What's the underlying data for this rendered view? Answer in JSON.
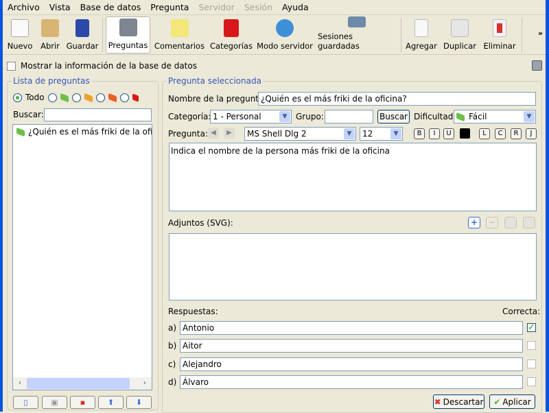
{
  "menu": [
    "Archivo",
    "Vista",
    "Base de datos",
    "Pregunta",
    "Servidor",
    "Sesión",
    "Ayuda"
  ],
  "menu_disabled": [
    "Servidor",
    "Sesión"
  ],
  "toolbar": {
    "nuevo": "Nuevo",
    "abrir": "Abrir",
    "guardar": "Guardar",
    "preguntas": "Preguntas",
    "comentarios": "Comentarios",
    "categorias": "Categorías",
    "modo_servidor": "Modo servidor",
    "sesiones": "Sesiones guardadas",
    "agregar": "Agregar",
    "duplicar": "Duplicar",
    "eliminar": "Eliminar",
    "more": "»"
  },
  "show_db_info": {
    "label": "Mostrar la información de la base de datos",
    "checked": false
  },
  "left": {
    "title": "Lista de preguntas",
    "filter_all": "Todo",
    "search_label": "Buscar:",
    "search_value": "",
    "items": [
      "¿Quién es el más friki de la oficina"
    ]
  },
  "right": {
    "title": "Pregunta seleccionada",
    "name_label": "Nombre de la pregunta:",
    "name_value": "¿Quién es el más friki de la oficina?",
    "category_label": "Categoría:",
    "category_value": "1 - Personal",
    "group_label": "Grupo:",
    "group_value": "",
    "search_button": "Buscar",
    "difficulty_label": "Dificultad:",
    "difficulty_value": "Fácil",
    "question_label": "Pregunta:",
    "font": "MS Shell Dlg 2",
    "size": "12",
    "format": [
      "B",
      "I",
      "U"
    ],
    "align": [
      "L",
      "C",
      "R",
      "J"
    ],
    "text": "Indica el nombre de la persona más friki de la oficina",
    "attachments_label": "Adjuntos (SVG):",
    "answers_label": "Respuestas:",
    "correct_label": "Correcta:",
    "answers": [
      {
        "key": "a)",
        "text": "Antonio",
        "correct": true
      },
      {
        "key": "b)",
        "text": "Aitor",
        "correct": false
      },
      {
        "key": "c)",
        "text": "Alejandro",
        "correct": false
      },
      {
        "key": "d)",
        "text": "Álvaro",
        "correct": false
      }
    ],
    "discard": "Descartar",
    "apply": "Aplicar"
  },
  "colors": {
    "accent": "#3557b8",
    "easy": "#6cbf4a",
    "medium": "#f0a030",
    "hard": "#e8602a",
    "extreme": "#d81818"
  }
}
